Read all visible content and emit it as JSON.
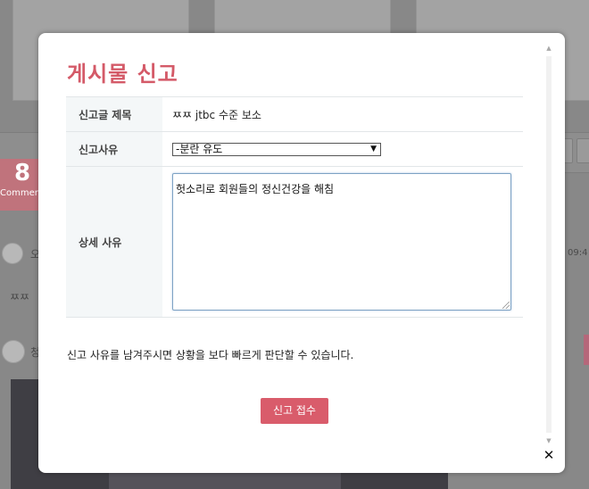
{
  "background": {
    "comment_count": "8",
    "comment_label": "Comments",
    "comment1_author_initial": "오",
    "comment1_time": "09:4",
    "comment1_text": "ㅉㅉ",
    "comment2_author_initial": "청"
  },
  "modal": {
    "title": "게시물 신고",
    "rows": {
      "title_label": "신고글 제목",
      "title_value": "ㅉㅉ jtbc 수준 보소",
      "reason_label": "신고사유",
      "reason_selected": "-분란 유도",
      "detail_label": "상세 사유",
      "detail_value": "헛소리로 회원들의 정신건강을 해침"
    },
    "notice": "신고 사유를 남겨주시면 상황을 보다 빠르게 판단할 수 있습니다.",
    "submit_label": "신고 접수",
    "close_icon": "✕"
  },
  "colors": {
    "accent": "#d95c6b",
    "title": "#d45a68",
    "label_bg": "#f4f7f8"
  }
}
